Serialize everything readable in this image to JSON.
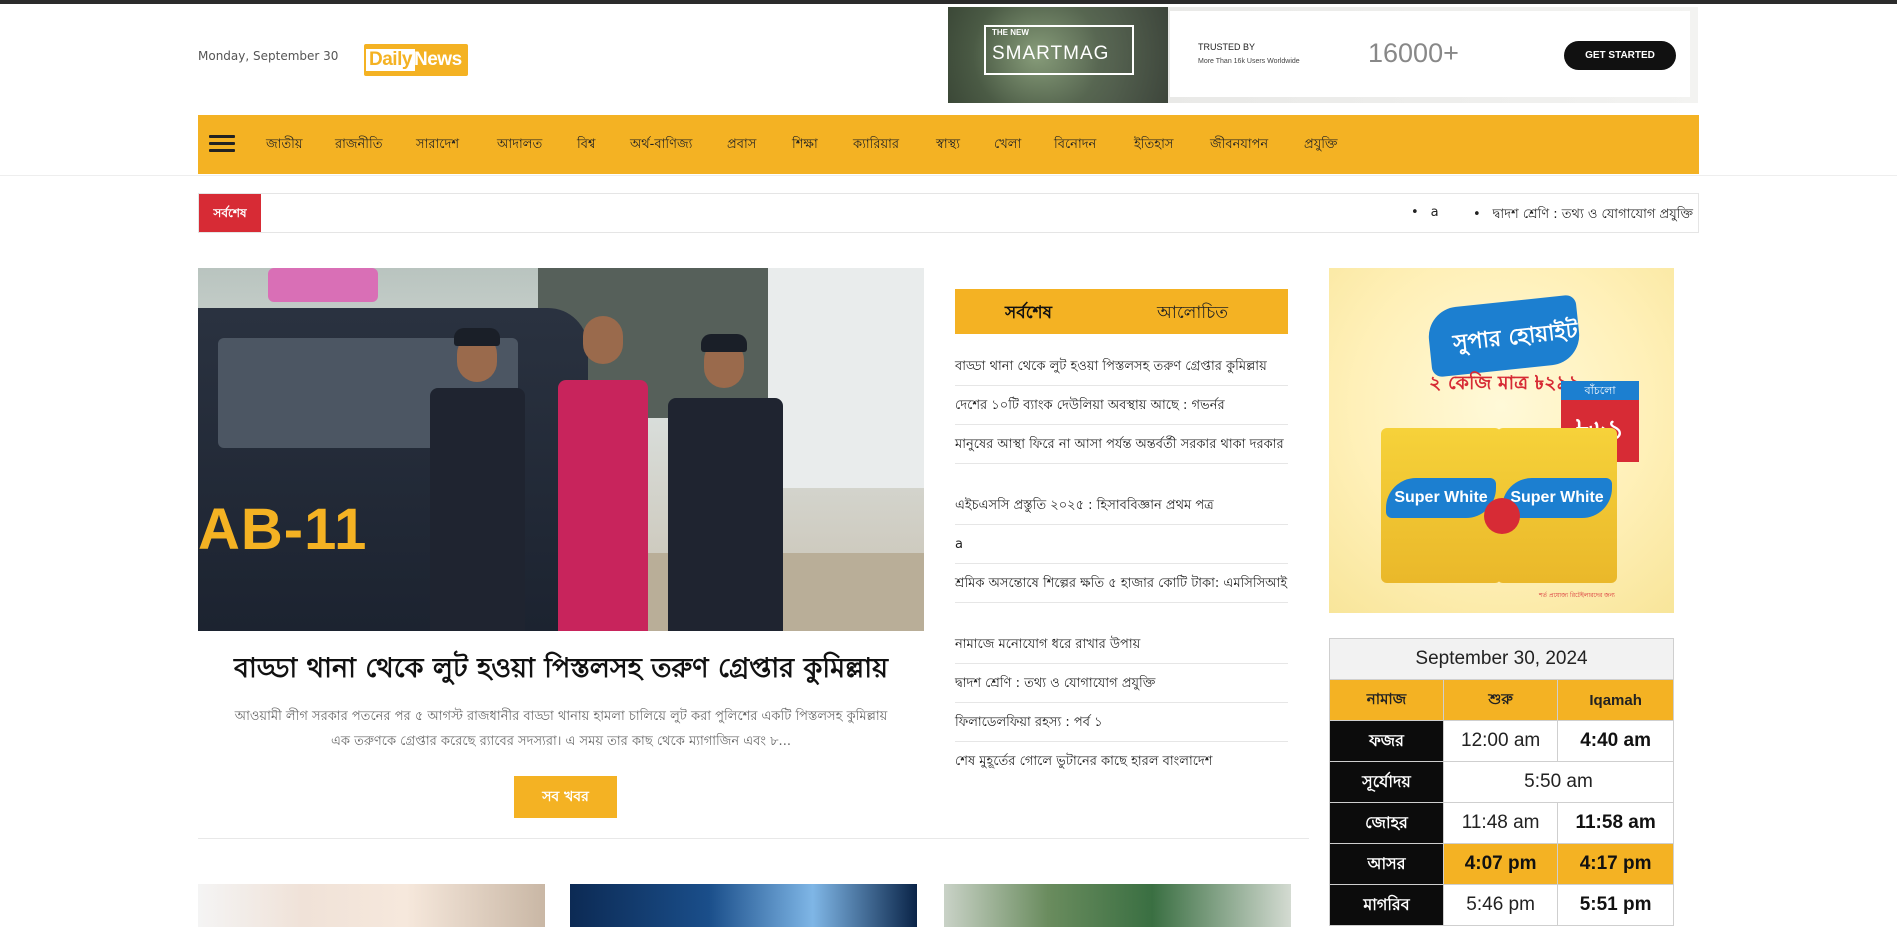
{
  "header": {
    "date": "Monday, September 30",
    "logo": {
      "word1": "Daily",
      "word2": "News"
    }
  },
  "banner_ad": {
    "box_small": "THE NEW",
    "box_big": "SMARTMAG",
    "trusted": "TRUSTED BY",
    "sub": "More Than 16k Users Worldwide",
    "count": "16000+",
    "cta": "GET STARTED"
  },
  "nav": {
    "items": [
      "জাতীয়",
      "রাজনীতি",
      "সারাদেশ",
      "আদালত",
      "বিশ্ব",
      "অর্থ-বাণিজ্য",
      "প্রবাস",
      "শিক্ষা",
      "ক্যারিয়ার",
      "স্বাস্থ্য",
      "খেলা",
      "বিনোদন",
      "ইতিহাস",
      "জীবনযাপন",
      "প্রযুক্তি"
    ]
  },
  "ticker": {
    "label": "সর্বশেষ",
    "items": [
      "a",
      "দ্বাদশ শ্রেণি : তথ্য ও যোগাযোগ প্রযুক্তি"
    ]
  },
  "lead": {
    "vehicle_text": "AB-11",
    "title": "বাড্ডা থানা থেকে লুট হওয়া পিস্তলসহ তরুণ গ্রেপ্তার কুমিল্লায়",
    "excerpt_line1": "আওয়ামী লীগ সরকার পতনের পর ৫ আগস্ট রাজধানীর বাড্ডা থানায় হামলা চালিয়ে লুট করা পুলিশের একটি পিস্তলসহ কুমিল্লায়",
    "excerpt_line2": "এক তরুণকে গ্রেপ্তার করেছে র‍্যাবের সদস্যরা। এ সময় তার কাছ থেকে ম্যাগাজিন এবং ৮...",
    "more_button": "সব খবর"
  },
  "tabs": {
    "active": "সর্বশেষ",
    "inactive": "আলোচিত"
  },
  "latest": [
    "বাড্ডা থানা থেকে লুট হওয়া পিস্তলসহ তরুণ গ্রেপ্তার কুমিল্লায়",
    "দেশের ১০টি ব্যাংক দেউলিয়া অবস্থায় আছে : গভর্নর",
    "মানুষের আস্থা ফিরে না আসা পর্যন্ত অন্তর্বর্তী সরকার থাকা দরকার",
    "এইচএসসি প্রস্তুতি ২০২৫ : হিসাববিজ্ঞান প্রথম পত্র",
    "a",
    "শ্রমিক অসন্তোষে শিল্পের ক্ষতি ৫ হাজার কোটি টাকা: এমসিসিআই",
    "নামাজে মনোযোগ ধরে রাখার উপায়",
    "দ্বাদশ শ্রেণি : তথ্য ও যোগাযোগ প্রযুক্তি",
    "ফিলাডেলফিয়া রহস্য : পর্ব ১",
    "শেষ মুহূর্তের গোলে ভুটানের কাছে হারল বাংলাদেশ"
  ],
  "side_ad": {
    "brand": "সুপার হোয়াইট",
    "price": "২ কেজি মাত্র ৳২৯৯",
    "badge_top": "বাঁচলো",
    "badge": "৳৬১",
    "pack_label": "Super White",
    "footnote": "শর্ত প্রযোজ্য রিটেইলারদের জন্য"
  },
  "prayer": {
    "date": "September 30, 2024",
    "headers": [
      "নামাজ",
      "শুরু",
      "Iqamah"
    ],
    "rows": [
      {
        "name": "ফজর",
        "start": "12:00 am",
        "iqamah": "4:40 am"
      },
      {
        "name": "সূর্যোদয়",
        "single": "5:50 am"
      },
      {
        "name": "জোহর",
        "start": "11:48 am",
        "iqamah": "11:58 am"
      },
      {
        "name": "আসর",
        "start": "4:07 pm",
        "iqamah": "4:17 pm"
      },
      {
        "name": "মাগরিব",
        "start": "5:46 pm",
        "iqamah": "5:51 pm"
      }
    ]
  }
}
